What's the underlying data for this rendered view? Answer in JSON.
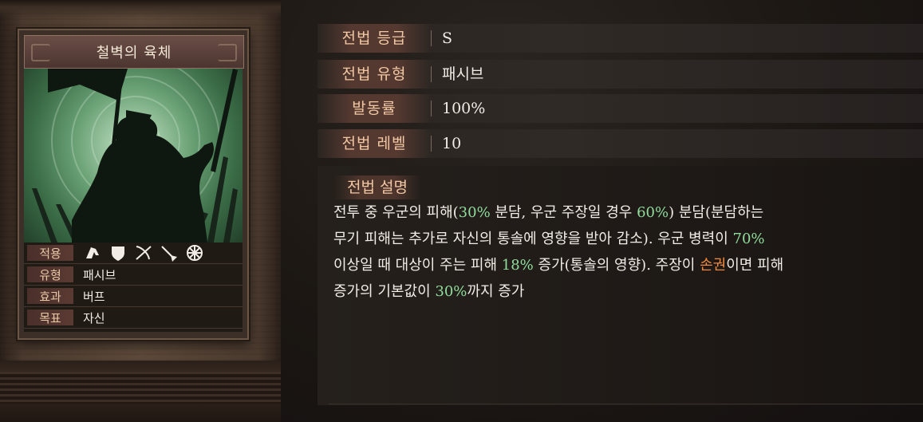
{
  "card": {
    "title": "철벽의 육체",
    "info": [
      {
        "key": "적용",
        "icons": [
          "cavalry-icon",
          "shield-icon",
          "bow-icon",
          "spear-icon",
          "wheel-icon"
        ]
      },
      {
        "key": "유형",
        "value": "패시브"
      },
      {
        "key": "효과",
        "value": "버프"
      },
      {
        "key": "목표",
        "value": "자신"
      }
    ]
  },
  "stats": [
    {
      "label": "전법 등급",
      "value": "S"
    },
    {
      "label": "전법 유형",
      "value": "패시브"
    },
    {
      "label": "발동률",
      "value": "100%"
    },
    {
      "label": "전법 레벨",
      "value": "10"
    }
  ],
  "description": {
    "label": "전법 설명",
    "segments": [
      {
        "t": "전투 중 우군의 피해(",
        "c": "n"
      },
      {
        "t": "30%",
        "c": "g"
      },
      {
        "t": " 분담, 우군 주장일 경우 ",
        "c": "n"
      },
      {
        "t": "60%",
        "c": "g"
      },
      {
        "t": ") 분담(분담하는\n무기 피해는 추가로 자신의 통솔에 영향을 받아 감소). 우군 병력이 ",
        "c": "n"
      },
      {
        "t": "70%",
        "c": "g"
      },
      {
        "t": "\n이상일 때 대상이 주는 피해 ",
        "c": "n"
      },
      {
        "t": "18%",
        "c": "g"
      },
      {
        "t": " 증가(통솔의 영향). 주장이 ",
        "c": "n"
      },
      {
        "t": "손권",
        "c": "o"
      },
      {
        "t": "이면 피해\n증가의 기본값이 ",
        "c": "n"
      },
      {
        "t": "30%",
        "c": "g"
      },
      {
        "t": "까지 증가",
        "c": "n"
      }
    ]
  },
  "colors": {
    "highlight_green": "#8fdc9c",
    "highlight_orange": "#f08a3c",
    "label": "#f2c7a3"
  }
}
